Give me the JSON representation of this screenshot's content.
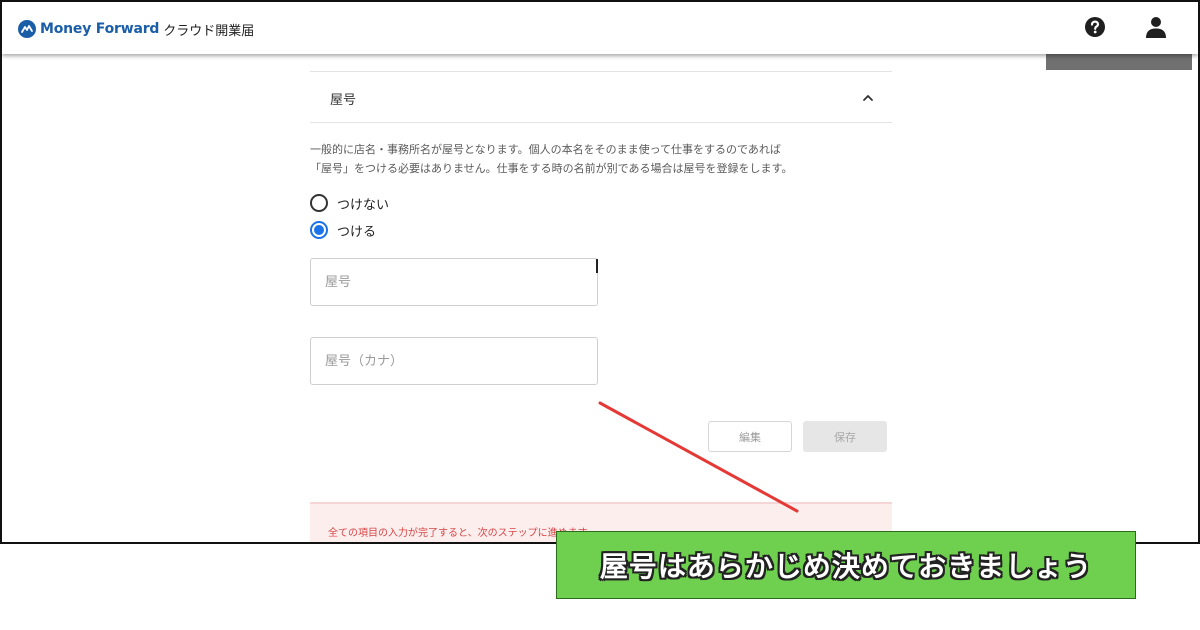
{
  "header": {
    "logo_brand": "Money Forward",
    "logo_product": "クラウド開業届",
    "help_icon": "question-circle-icon",
    "user_icon": "user-icon"
  },
  "section": {
    "title": "屋号",
    "chevron_icon": "chevron-up-icon",
    "description_line1": "一般的に店名・事務所名が屋号となります。個人の本名をそのまま使って仕事をするのであれば",
    "description_line2": "「屋号」をつける必要はありません。仕事をする時の名前が別である場合は屋号を登録をします。"
  },
  "radio_options": [
    {
      "label": "つけない",
      "checked": false
    },
    {
      "label": "つける",
      "checked": true
    }
  ],
  "fields": {
    "yago_placeholder": "屋号",
    "yago_kana_placeholder": "屋号（カナ）"
  },
  "buttons": {
    "edit_label": "編集",
    "save_label": "保存"
  },
  "notice": {
    "text": "全ての項目の入力が完了すると、次のステップに進めます"
  },
  "annotation": {
    "caption": "屋号はあらかじめ決めておきましょう"
  },
  "colors": {
    "brand": "#1b5ea8",
    "radio_selected": "#1a73e8",
    "notice_text": "#d64545",
    "notice_bg": "#fdeeee",
    "caption_bg": "#6fd04f",
    "arrow": "#e53935"
  }
}
